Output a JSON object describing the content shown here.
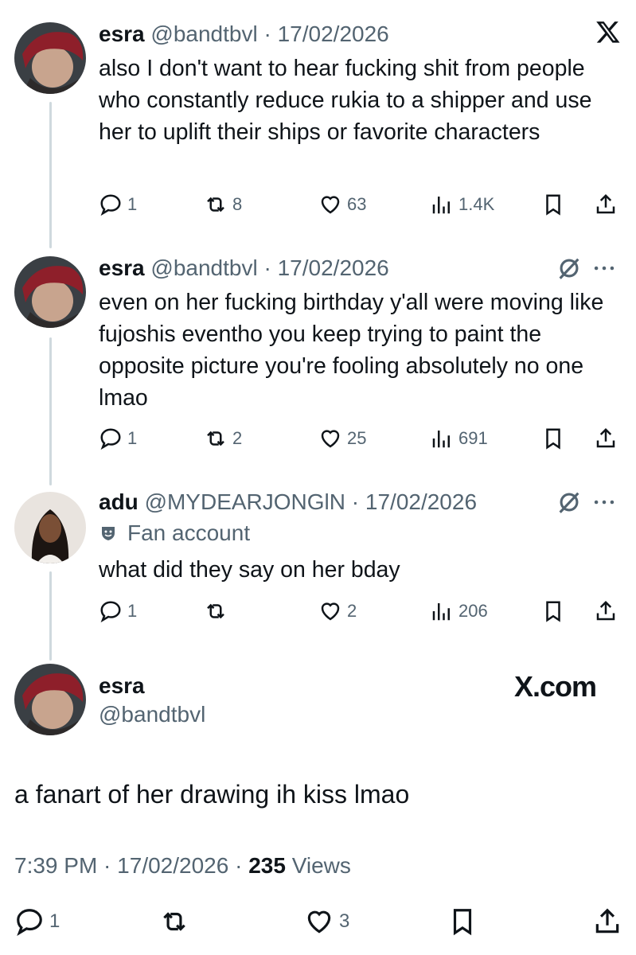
{
  "thread": [
    {
      "name": "esra",
      "handle": "@bandtbvl",
      "sep": " · ",
      "date": "17/02/2026",
      "text": "also I don't want to hear fucking shit from people who constantly reduce rukia to a shipper and use her to uplift their ships or favorite characters",
      "replies": "1",
      "reposts": "8",
      "likes": "63",
      "views": "1.4K"
    },
    {
      "name": "esra",
      "handle": "@bandtbvl",
      "sep": " · ",
      "date": "17/02/2026",
      "text": "even on her fucking birthday y'all were moving like fujoshis eventho you keep trying to paint the opposite picture you're fooling absolutely no one lmao",
      "replies": "1",
      "reposts": "2",
      "likes": "25",
      "views": "691"
    },
    {
      "name": "adu",
      "handle": "@MYDEARJONGlN",
      "sep": " · ",
      "date": "17/02/2026",
      "badge": "Fan account",
      "text": "what did they say on her bday",
      "replies": "1",
      "reposts": "",
      "likes": "2",
      "views": "206"
    }
  ],
  "main": {
    "name": "esra",
    "handle": "@bandtbvl",
    "brand": "X.com",
    "text": "a fanart of her drawing ih kiss lmao",
    "time": "7:39 PM",
    "date": "17/02/2026",
    "views_count": "235",
    "views_label": "Views",
    "replies": "1",
    "likes": "3"
  },
  "icons": {
    "reply": "reply-icon",
    "repost": "repost-icon",
    "like": "heart-icon",
    "views": "views-icon",
    "bookmark": "bookmark-icon",
    "share": "share-icon",
    "grok": "grok-icon",
    "more": "more-icon",
    "x_logo": "x-logo-icon",
    "badge": "fan-account-icon"
  }
}
